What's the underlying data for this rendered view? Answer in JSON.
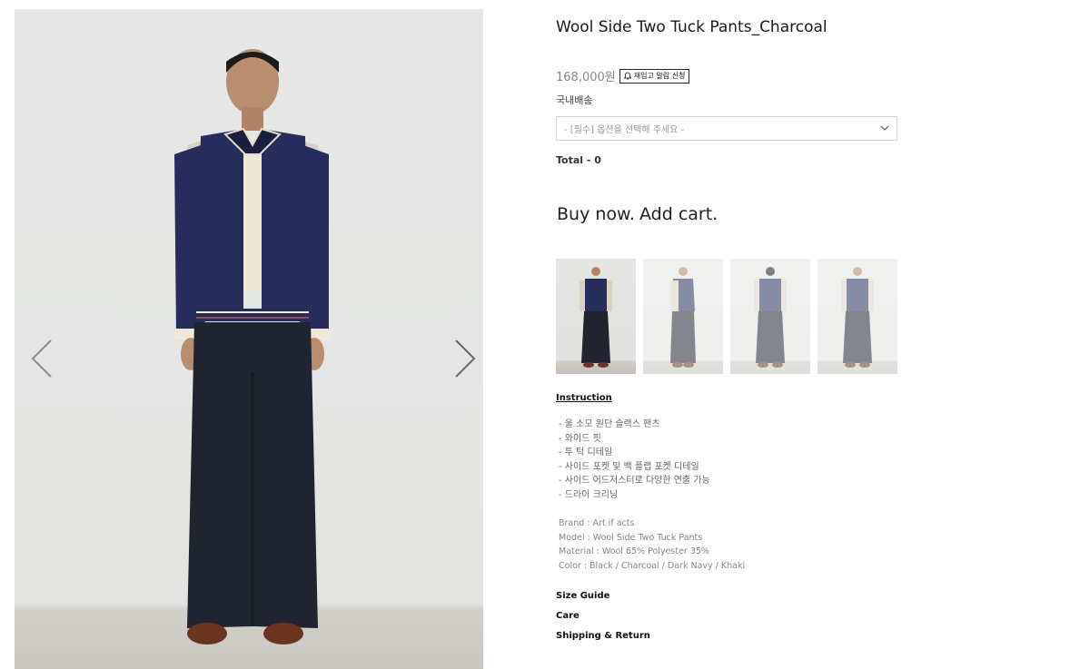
{
  "product": {
    "title": "Wool Side Two Tuck Pants_Charcoal",
    "price": "168,000원",
    "restock_label": "재입고 알림 신청",
    "shipping": "국내배송",
    "option_placeholder": "- [필수] 옵션을 선택해 주세요 -",
    "total": "Total - 0",
    "buy_label": "Buy now.",
    "cart_label": "Add cart."
  },
  "gallery": {
    "prev_icon": "chevron-left-icon",
    "next_icon": "chevron-right-icon",
    "thumbnails": [
      {
        "view": "front",
        "selected": true
      },
      {
        "view": "side",
        "selected": false
      },
      {
        "view": "back",
        "selected": false
      },
      {
        "view": "front-alt",
        "selected": false
      }
    ]
  },
  "details": {
    "instruction_label": "Instruction",
    "features": [
      "- 울 소모 원단 슬랙스 팬츠",
      "- 와이드 핏",
      "- 투 턱 디테일",
      "- 사이드 포켓 및 백 플랩 포켓 디테일",
      "- 사이드 어드저스터로 다양한 연출 가능",
      "- 드라이 크리닝"
    ],
    "specs": [
      "Brand : Art if acts",
      "Model : Wool Side Two Tuck Pants",
      "Material : Wool 65% Polyester 35%",
      "Color : Black / Charcoal / Dark Navy / Khaki"
    ]
  },
  "links": {
    "size_guide": "Size Guide",
    "care": "Care",
    "shipping_return": "Shipping & Return"
  },
  "colors": {
    "jacket_body": "#262d5c",
    "sleeve": "#d9d2c2",
    "pants": "#1f2430",
    "shoes": "#6a3420"
  }
}
